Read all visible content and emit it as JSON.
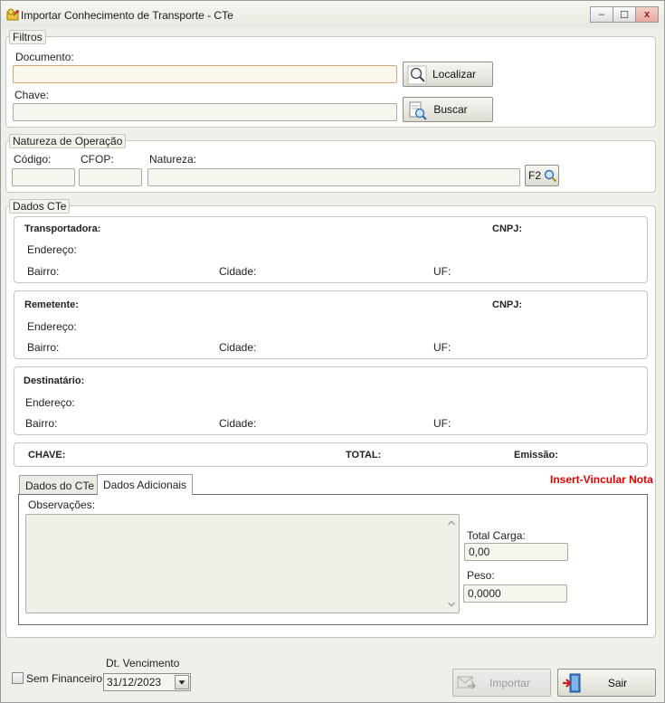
{
  "window": {
    "title": "Importar Conhecimento de Transporte - CTe",
    "controls": {
      "minimize": "–",
      "maximize": "☐",
      "close": "x"
    }
  },
  "filtros": {
    "legend": "Filtros",
    "documento_label": "Documento:",
    "documento_value": "",
    "chave_label": "Chave:",
    "chave_value": "",
    "localizar_label": "Localizar",
    "buscar_label": "Buscar"
  },
  "natureza": {
    "legend": "Natureza de Operação",
    "codigo_label": "Código:",
    "cfop_label": "CFOP:",
    "natureza_label": "Natureza:",
    "codigo_value": "",
    "cfop_value": "",
    "natureza_value": "",
    "f2_label": "F2"
  },
  "dados_cte": {
    "legend": "Dados CTe",
    "transportadora": {
      "title": "Transportadora:",
      "cnpj": "CNPJ:",
      "endereco": "Endereço:",
      "bairro": "Bairro:",
      "cidade": "Cidade:",
      "uf": "UF:"
    },
    "remetente": {
      "title": "Remetente:",
      "cnpj": "CNPJ:",
      "endereco": "Endereço:",
      "bairro": "Bairro:",
      "cidade": "Cidade:",
      "uf": "UF:"
    },
    "destinatario": {
      "title": "Destinatário:",
      "endereco": "Endereço:",
      "bairro": "Bairro:",
      "cidade": "Cidade:",
      "uf": "UF:"
    },
    "summary": {
      "chave": "CHAVE:",
      "total": "TOTAL:",
      "emissao": "Emissão:"
    },
    "insert_link": "Insert-Vincular Nota",
    "tabs": [
      {
        "label": "Dados do CTe"
      },
      {
        "label": "Dados Adicionais"
      }
    ],
    "observacoes_label": "Observações:",
    "total_carga_label": "Total Carga:",
    "total_carga_value": "0,00",
    "peso_label": "Peso:",
    "peso_value": "0,0000"
  },
  "footer": {
    "sem_financeiro_label": "Sem Financeiro",
    "dt_vencimento_label": "Dt. Vencimento",
    "dt_vencimento_value": "31/12/2023",
    "importar_label": "Importar",
    "sair_label": "Sair"
  },
  "colors": {
    "accent_red": "#e00000",
    "window_bg": "#f0f0ea"
  }
}
